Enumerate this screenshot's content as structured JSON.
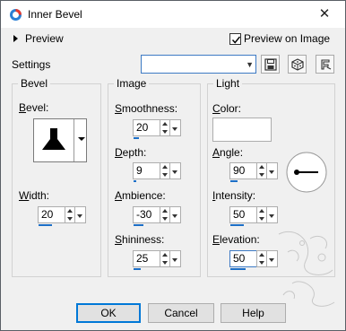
{
  "window": {
    "title": "Inner Bevel",
    "close_glyph": "✕"
  },
  "preview": {
    "label": "Preview",
    "on_image_label": "Preview on Image",
    "on_image_checked": true
  },
  "settings": {
    "label": "Settings",
    "value": ""
  },
  "bevel_group": {
    "title": "Bevel",
    "bevel_label_u": "B",
    "bevel_label_rest": "evel:",
    "width_label_u": "W",
    "width_label_rest": "idth:",
    "width": {
      "value": "20",
      "level": 0.5
    }
  },
  "image_group": {
    "title": "Image",
    "smoothness": {
      "label_u": "S",
      "label_rest": "moothness:",
      "value": "20",
      "level": 0.2
    },
    "depth": {
      "label_u": "D",
      "label_rest": "epth:",
      "value": "9",
      "level": 0.09
    },
    "ambience": {
      "label_u": "A",
      "label_rest": "mbience:",
      "value": "-30",
      "level": 0.35
    },
    "shininess": {
      "label_u": "S",
      "label_rest": "hininess:",
      "value": "25",
      "level": 0.25
    }
  },
  "light_group": {
    "title": "Light",
    "color": {
      "label_u": "C",
      "label_rest": "olor:",
      "value": "#ffffff"
    },
    "angle": {
      "label_u": "A",
      "label_rest": "ngle:",
      "value": "90",
      "level": 0.25
    },
    "intensity": {
      "label_u": "I",
      "label_rest": "ntensity:",
      "value": "50",
      "level": 0.5
    },
    "elevation": {
      "label_u": "E",
      "label_rest": "levation:",
      "value": "50",
      "level": 0.55
    }
  },
  "buttons": {
    "ok": "OK",
    "cancel": "Cancel",
    "help": "Help"
  },
  "icons": {
    "app": "paint-icon",
    "save": "save-icon",
    "randomize": "dice-icon",
    "reset": "reset-icon",
    "angle_dial": "angle-dial-icon",
    "bevel_shape": "bevel-shape-icon"
  },
  "colors": {
    "accent": "#1d6fc7",
    "focus_border": "#0078d7"
  }
}
